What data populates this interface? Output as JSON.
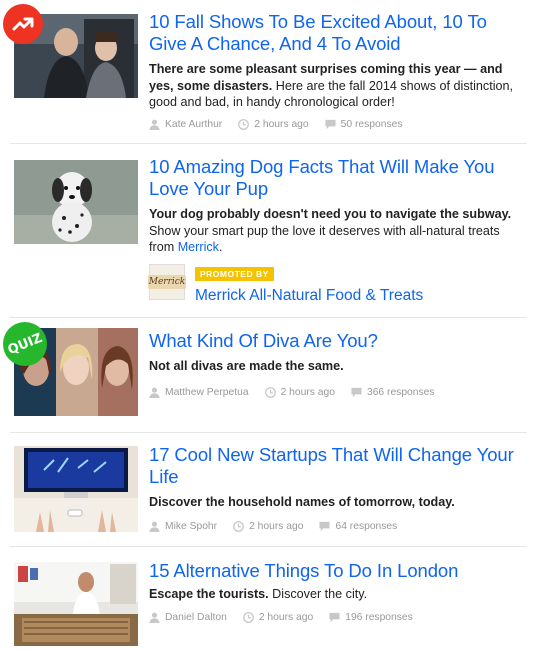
{
  "articles": [
    {
      "title": "10 Fall Shows To Be Excited About, 10 To Give A Chance, And 4 To Avoid",
      "desc_bold": "There are some pleasant surprises coming this year — and yes, some disasters.",
      "desc_rest": " Here are the fall 2014 shows of distinction, good and bad, in handy chronological order!",
      "author": "Kate Aurthur",
      "time": "2 hours ago",
      "responses": "50 responses",
      "badge": "trending"
    },
    {
      "title": "10 Amazing Dog Facts That Will Make You Love Your Pup",
      "desc_bold": "Your dog probably doesn't need you to navigate the subway.",
      "desc_rest": " Show your smart pup the love it deserves with all-natural treats from ",
      "desc_link": "Merrick",
      "desc_end": ".",
      "promo_tag": "PROMOTED BY",
      "promo_name": "Merrick All-Natural Food & Treats",
      "promo_logo": "Merrick"
    },
    {
      "title": "What Kind Of Diva Are You?",
      "desc_bold": "Not all divas are made the same.",
      "author": "Matthew Perpetua",
      "time": "2 hours ago",
      "responses": "366 responses",
      "badge": "QUIZ"
    },
    {
      "title": "17 Cool New Startups That Will Change Your Life",
      "desc_bold": "Discover the household names of tomorrow, today.",
      "author": "Mike Spohr",
      "time": "2 hours ago",
      "responses": "64 responses"
    },
    {
      "title": "15 Alternative Things To Do In London",
      "desc_bold": "Escape the tourists.",
      "desc_rest": " Discover the city.",
      "author": "Daniel Dalton",
      "time": "2 hours ago",
      "responses": "196 responses"
    }
  ],
  "colors": {
    "link": "#0f65ef",
    "trending": "#ee3322",
    "quiz": "#27b72c",
    "promo": "#f3c300",
    "meta": "#999999"
  },
  "icons": {
    "author": "user-icon",
    "time": "clock-icon",
    "responses": "comment-icon",
    "trending": "trending-arrow-icon"
  }
}
